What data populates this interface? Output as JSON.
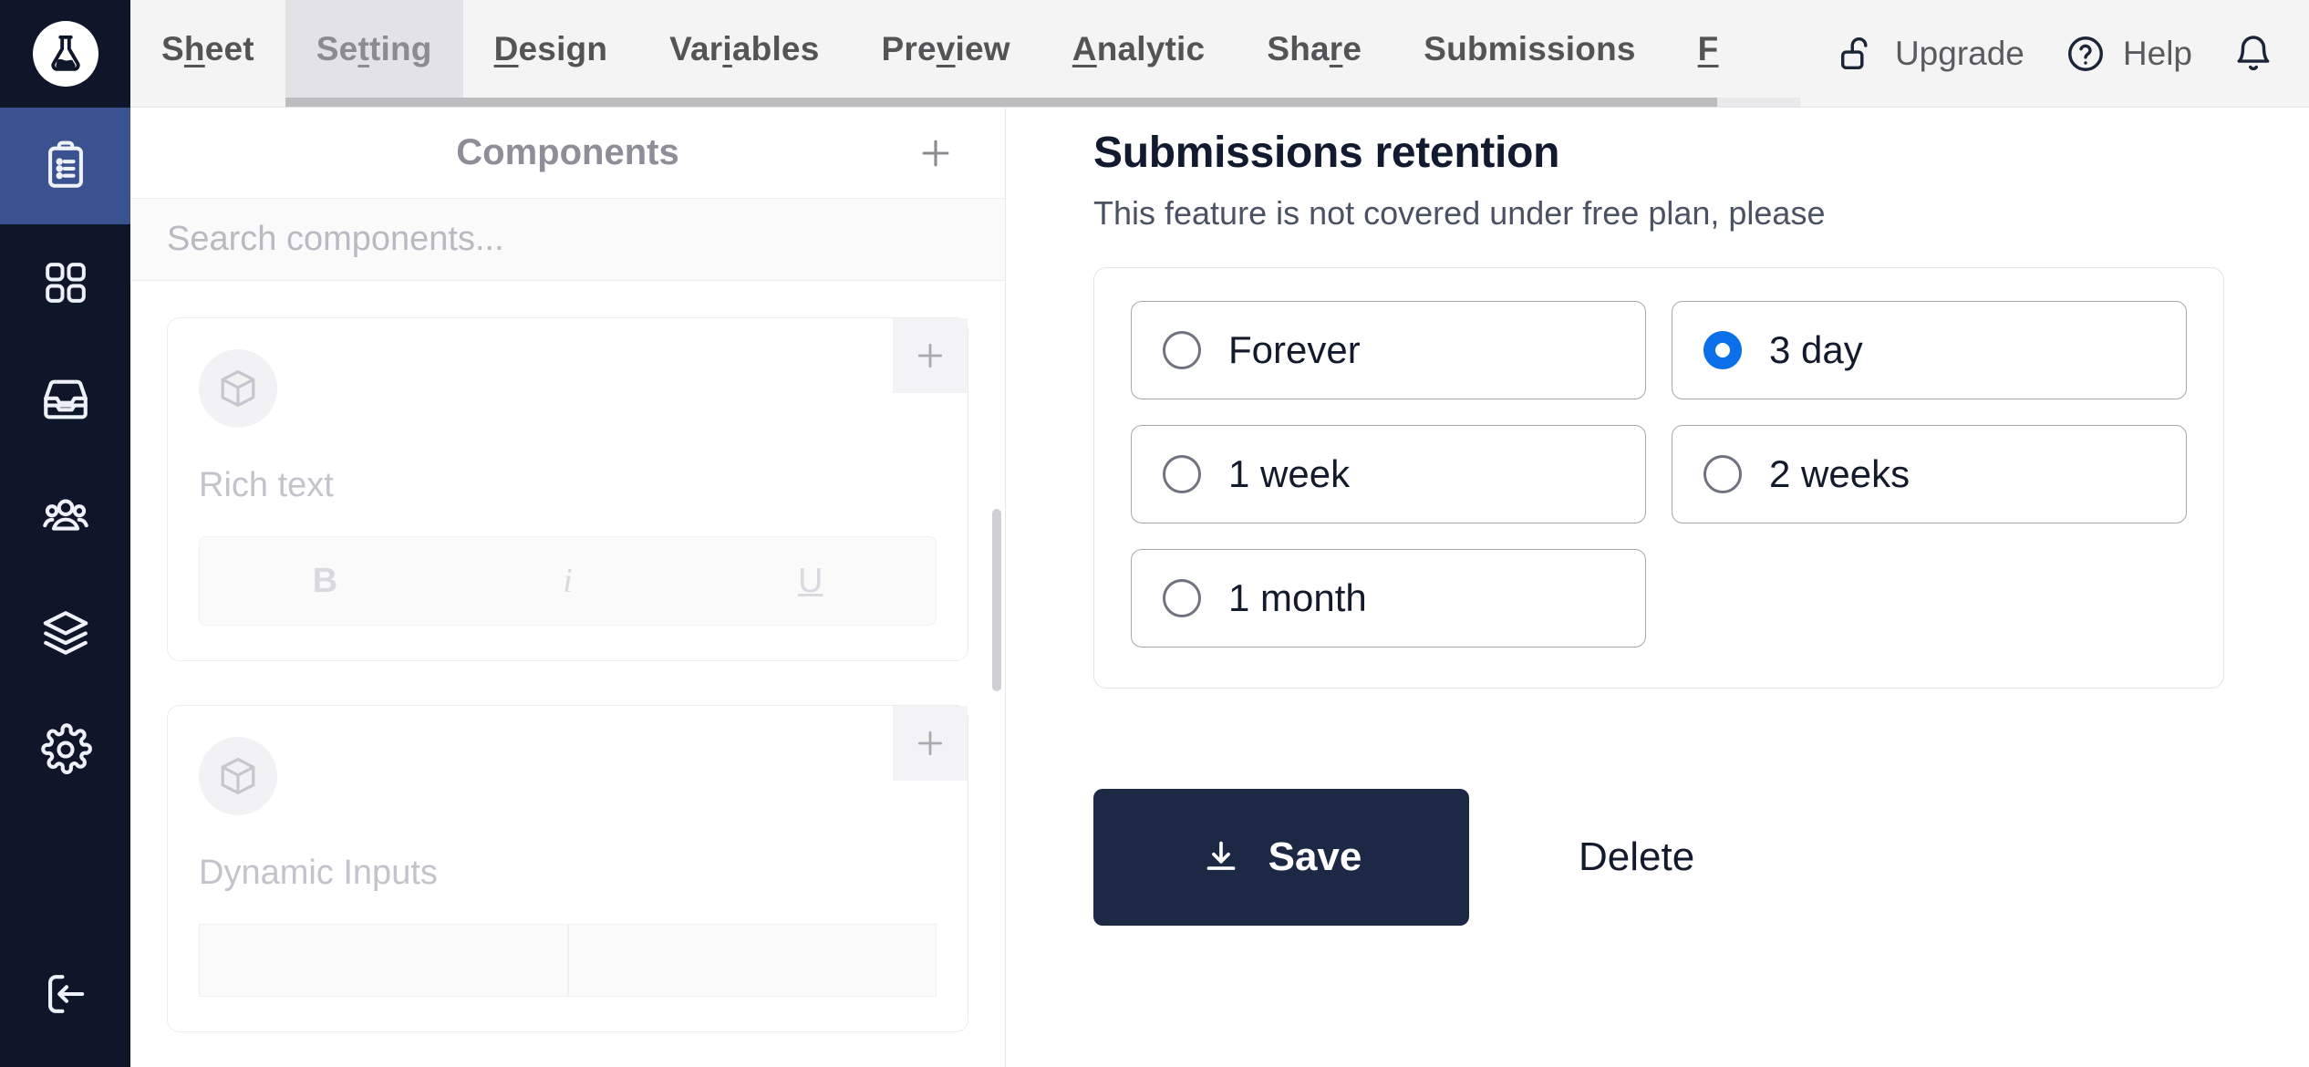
{
  "brand": {
    "logo_icon": "flask-icon",
    "accent": "#3b5291",
    "rail_bg": "#0f1629"
  },
  "rail": {
    "items": [
      {
        "name": "clipboard-list-icon",
        "active": true
      },
      {
        "name": "grid-apps-icon",
        "active": false
      },
      {
        "name": "inbox-archive-icon",
        "active": false
      },
      {
        "name": "users-group-icon",
        "active": false
      },
      {
        "name": "layers-icon",
        "active": false
      },
      {
        "name": "gear-icon",
        "active": false
      }
    ],
    "logout": {
      "name": "logout-icon"
    }
  },
  "topbar": {
    "tabs": [
      {
        "label": "Sheet",
        "accel_index": 1,
        "active": false
      },
      {
        "label": "Setting",
        "accel_index": 2,
        "active": true
      },
      {
        "label": "Design",
        "accel_index": 0,
        "active": false
      },
      {
        "label": "Variables",
        "accel_index": 3,
        "active": false
      },
      {
        "label": "Preview",
        "accel_index": 4,
        "active": false
      },
      {
        "label": "Analytic",
        "accel_index": 0,
        "active": false
      },
      {
        "label": "Share",
        "accel_index": 4,
        "active": false
      },
      {
        "label": "Submissions",
        "accel_index": -1,
        "active": false
      },
      {
        "label": "F",
        "accel_index": 0,
        "active": false
      }
    ],
    "upgrade_label": "Upgrade",
    "upgrade_icon": "unlock-icon",
    "help_label": "Help",
    "help_icon": "question-circle-icon",
    "notifications_icon": "bell-icon"
  },
  "components_panel": {
    "title": "Components",
    "add_icon": "plus-icon",
    "search": {
      "placeholder": "Search components...",
      "value": ""
    },
    "cards": [
      {
        "name": "Rich text",
        "thumb_icon": "cube-icon",
        "add_icon": "plus-icon",
        "toolbar": [
          "B",
          "i",
          "U"
        ]
      },
      {
        "name": "Dynamic Inputs",
        "thumb_icon": "cube-icon",
        "add_icon": "plus-icon",
        "toolbar": []
      }
    ]
  },
  "settings": {
    "section_title": "Submissions retention",
    "section_subtitle": "This feature is not covered under free plan, please",
    "retention_options": [
      {
        "label": "Forever",
        "checked": false
      },
      {
        "label": "3 day",
        "checked": true
      },
      {
        "label": "1 week",
        "checked": false
      },
      {
        "label": "2 weeks",
        "checked": false
      },
      {
        "label": "1 month",
        "checked": false
      }
    ],
    "save_label": "Save",
    "save_icon": "download-icon",
    "delete_label": "Delete",
    "selected_color": "#0a6fe8",
    "save_bg": "#1d2844"
  }
}
